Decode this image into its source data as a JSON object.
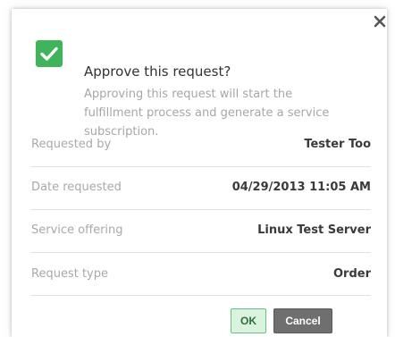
{
  "dialog": {
    "title": "Approve this request?",
    "description": "Approving this request will start the fulfillment process and generate a service subscription.",
    "icons": {
      "status": "checkmark-icon",
      "close": "close-icon"
    },
    "details": [
      {
        "label": "Requested by",
        "value": "Tester Too"
      },
      {
        "label": "Date requested",
        "value": "04/29/2013 11:05 AM"
      },
      {
        "label": "Service offering",
        "value": "Linux Test Server"
      },
      {
        "label": "Request type",
        "value": "Order"
      }
    ],
    "buttons": {
      "ok_label": "OK",
      "cancel_label": "Cancel"
    }
  },
  "colors": {
    "success_green": "#3fb45b",
    "ok_button_bg": "#d9f3de",
    "ok_button_border": "#67c17b",
    "cancel_button_bg": "#6f6f6f",
    "label_gray": "#a9a9a9",
    "value_dark": "#3a3a3a"
  }
}
